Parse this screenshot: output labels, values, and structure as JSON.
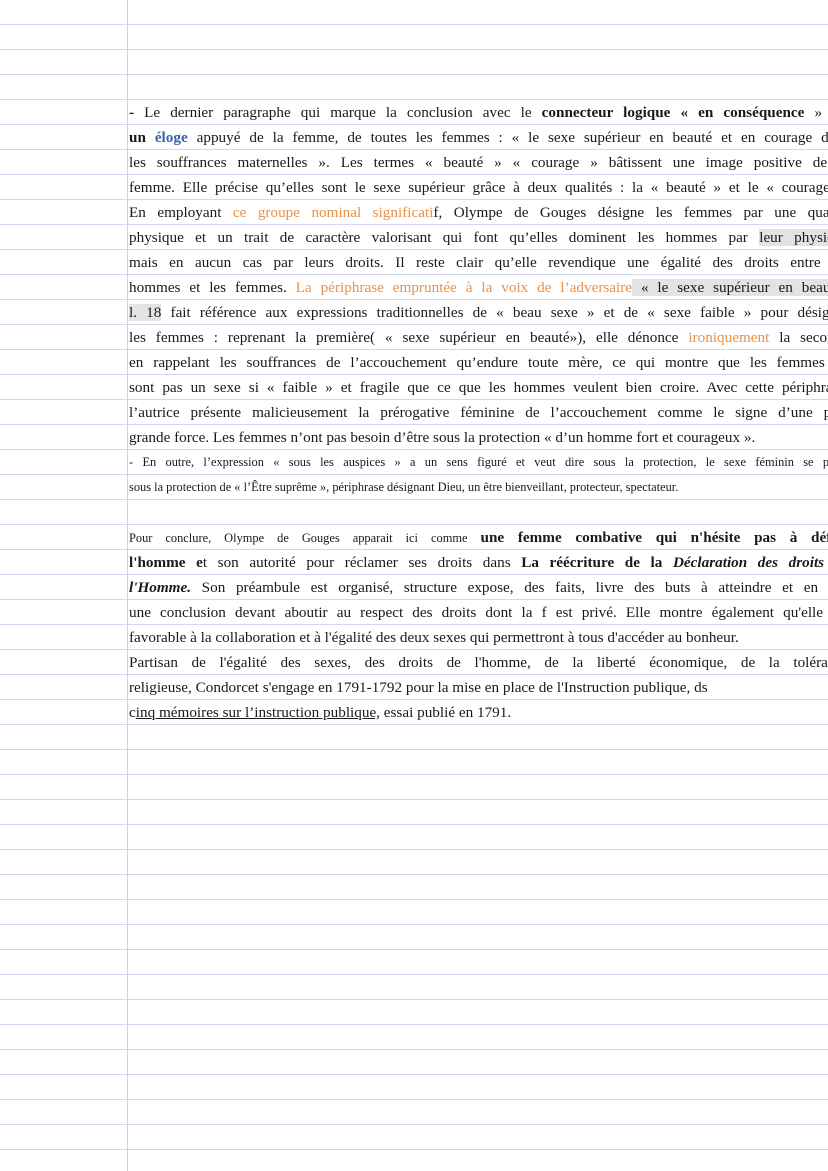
{
  "p1": {
    "l1": {
      "a": "- ",
      "b": "Le dernier paragraphe qui marque la conclusion avec le ",
      "c": "connecteur logique « en conséquence",
      "d": " » est"
    },
    "l2": {
      "a": "un ",
      "b": "éloge",
      "c": " appuyé de la femme, de toutes les femmes : « le sexe supérieur en beauté et en courage dans"
    },
    "l3": "les souffrances maternelles ». Les termes « beauté » « courage » bâtissent une image positive de la",
    "l4": "femme. Elle précise qu’elles sont le sexe supérieur grâce à deux qualités : la « beauté » et le « courage ».",
    "l5": {
      "a": "En employant ",
      "b": "ce groupe nominal significati",
      "c": "f, Olympe de Gouges désigne les femmes par une qualité"
    },
    "l6": {
      "a": "physique et un trait de caractère valorisant qui font qu’elles dominent les hommes par ",
      "b": "leur physique"
    },
    "l7": "mais en aucun cas par leurs droits. Il reste clair qu’elle revendique une égalité des droits entre les",
    "l8": {
      "a": "hommes et les femmes. ",
      "b": "La périphrase empruntée à la voix de l’adversaire",
      "c": " « le sexe supérieur en beauté»"
    },
    "l9": {
      "a": "l. 18",
      "b": " fait référence aux expressions traditionnelles de « beau sexe » et de « sexe faible » pour désigner"
    },
    "l10": {
      "a": "les femmes : reprenant la première( « sexe supérieur en beauté»), elle dénonce ",
      "b": "ironiquement",
      "c": " la seconde"
    },
    "l11": "en rappelant les souffrances de l’accouchement qu’endure toute mère, ce qui montre que les femmes ne",
    "l12": "sont pas un sexe si « faible » et fragile que ce que les hommes veulent bien croire. Avec cette périphrase,",
    "l13": "l’autrice présente malicieusement la prérogative féminine de l’accouchement comme le signe d’une plus",
    "l14": "grande force. Les femmes n’ont pas besoin d’être sous la protection « d’un homme fort et courageux ».",
    "l15": "- En outre, l’expression « sous les auspices » a un sens figuré et veut dire sous la protection, le sexe féminin se place",
    "l16": "sous la protection de « l’Être suprême », périphrase désignant Dieu, un être bienveillant, protecteur, spectateur."
  },
  "p2": {
    "l1": {
      "a": "Pour conclure, Olympe de Gouges apparait ici comme ",
      "b": "une femme combative qui n'hésite pas à défier"
    },
    "l2": {
      "a": "l'homme e",
      "b": "t son autorité pour réclamer ses droits dans ",
      "c": "La réécriture de la ",
      "d": "Déclaration des droits de"
    },
    "l3": {
      "a": "l'Homme.",
      "b": " Son préambule est organisé, structure expose, des faits, livre des buts à atteindre et en tire"
    },
    "l4": "une conclusion devant aboutir au respect des droits dont la f est privé. Elle montre également qu'elle est",
    "l5": "favorable à la collaboration et à l'égalité des deux sexes qui permettront à tous d'accéder au bonheur.",
    "l6": "Partisan de l'égalité des sexes, des droits de l'homme, de la liberté économique, de la tolérance",
    "l7": "religieuse, Condorcet s'engage en 1791-1792 pour la mise en place de l'Instruction publique, ds",
    "l8": {
      "a": "c",
      "b": "inq mémoires sur l’instruction publique,",
      "c": " essai publié en 1791."
    }
  }
}
